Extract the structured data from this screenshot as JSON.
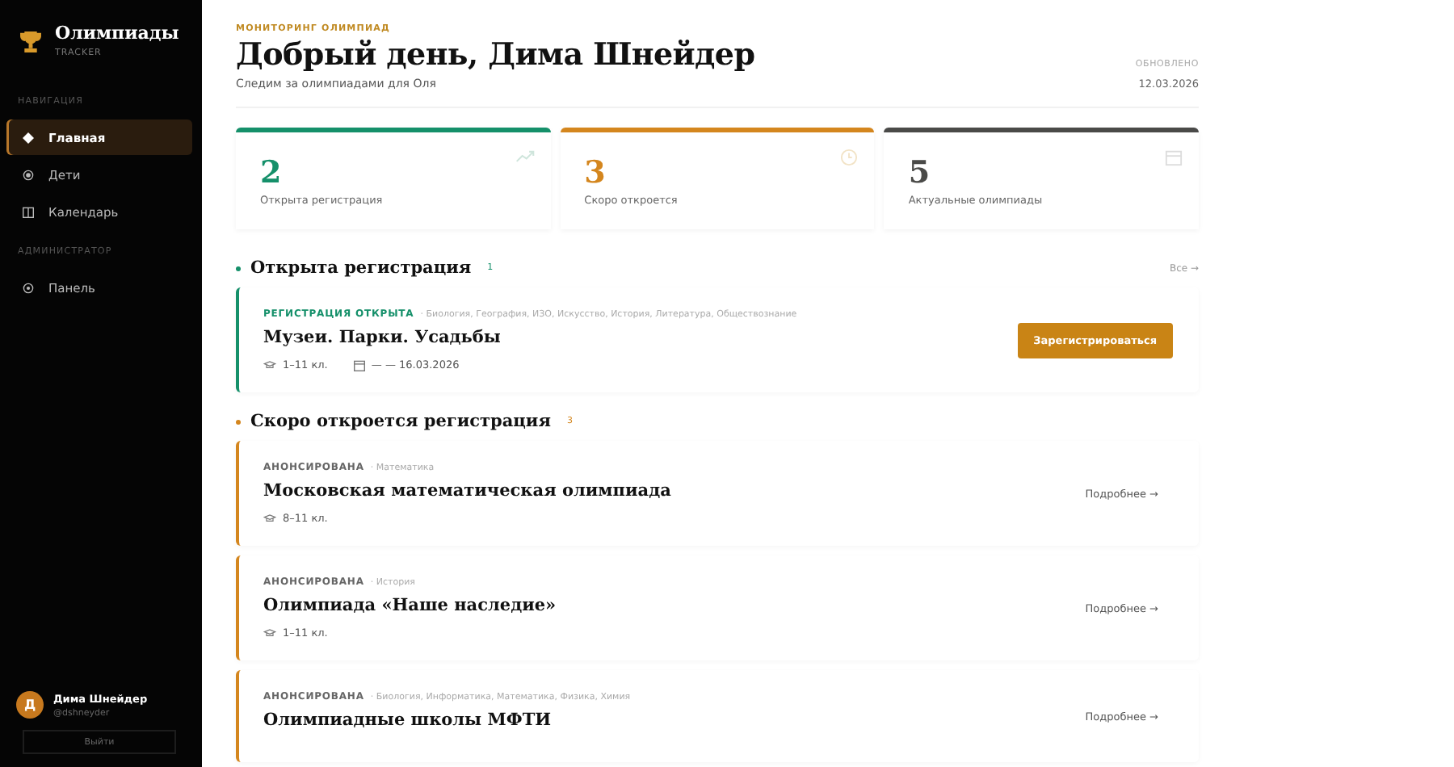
{
  "sidebar": {
    "brand": {
      "title": "Олимпиады",
      "subtitle": "TRACKER"
    },
    "groups": [
      {
        "label": "НАВИГАЦИЯ",
        "items": [
          {
            "label": "Главная",
            "kind": "home",
            "selected": true
          },
          {
            "label": "Дети",
            "kind": "children",
            "selected": false
          },
          {
            "label": "Календарь",
            "kind": "calendar",
            "selected": false
          }
        ]
      },
      {
        "label": "АДМИНИСТРАТОР",
        "items": [
          {
            "label": "Панель",
            "kind": "admin",
            "selected": false
          }
        ]
      }
    ],
    "user": {
      "initial": "Д",
      "name": "Дима Шнейдер",
      "handle": "@dshneyder"
    },
    "logout": "Выйти"
  },
  "header": {
    "eyebrow": "МОНИТОРИНГ ОЛИМПИАД",
    "title": "Добрый день, Дима Шнейдер",
    "subtitle": "Следим за олимпиадами для Оля",
    "updated_label": "ОБНОВЛЕНО",
    "updated_date": "12.03.2026"
  },
  "stats": [
    {
      "value": "2",
      "label": "Открыта регистрация",
      "color": "#15906a",
      "kind": "open"
    },
    {
      "value": "3",
      "label": "Скоро откроется",
      "color": "#d4861e",
      "kind": "soon"
    },
    {
      "value": "5",
      "label": "Актуальные олимпиады",
      "color": "#4a4a48",
      "kind": "total"
    }
  ],
  "sections": [
    {
      "title": "Открыта регистрация",
      "count": "1",
      "color": "#15906a",
      "all_link": "Все →",
      "cards": [
        {
          "kind": "open",
          "status": "РЕГИСТРАЦИЯ ОТКРЫТА",
          "subjects": "· Биология, География, ИЗО, Искусство, История, Литература, Обществознание",
          "title": "Музеи. Парки. Усадьбы",
          "grades": "1–11 кл.",
          "dates": "— — 16.03.2026",
          "action": "Зарегистрироваться"
        }
      ]
    },
    {
      "title": "Скоро откроется регистрация",
      "count": "3",
      "color": "#d4861e",
      "cards": [
        {
          "kind": "announced",
          "status": "АНОНСИРОВАНА",
          "subjects": "· Математика",
          "title": "Московская математическая олимпиада",
          "grades": "8–11 кл.",
          "action": "Подробнее →"
        },
        {
          "kind": "announced",
          "status": "АНОНСИРОВАНА",
          "subjects": "· История",
          "title": "Олимпиада «Наше наследие»",
          "grades": "1–11 кл.",
          "action": "Подробнее →"
        },
        {
          "kind": "announced",
          "status": "АНОНСИРОВАНА",
          "subjects": "· Биология, Информатика, Математика, Физика, Химия",
          "title": "Олимпиадные школы МФТИ",
          "action": "Подробнее →"
        }
      ]
    }
  ]
}
